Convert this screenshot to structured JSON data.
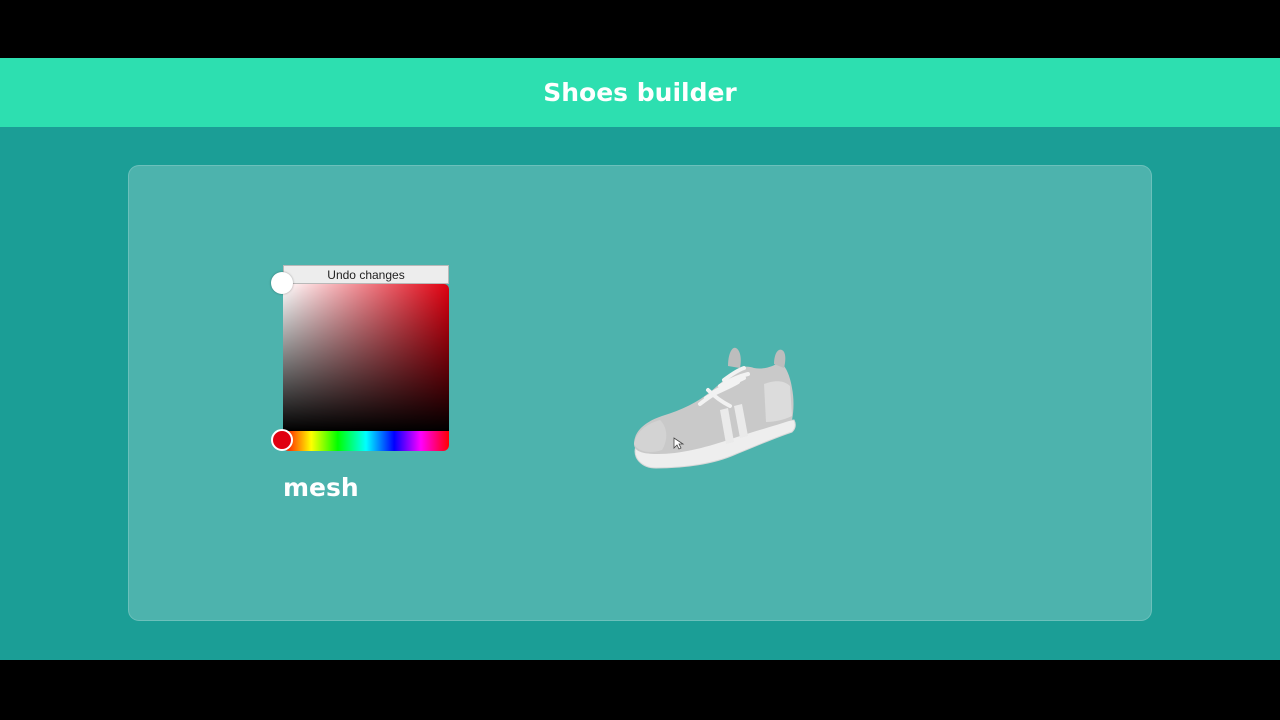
{
  "header": {
    "title": "Shoes builder"
  },
  "color_picker": {
    "undo_label": "Undo changes",
    "selected_color": "#e00010",
    "hue_color": "#ff0000"
  },
  "part": {
    "label": "mesh"
  },
  "shoe": {
    "icon": "shoe-3d-model",
    "color": "#c9c9c9"
  },
  "colors": {
    "header_bg": "#2ddfb0",
    "app_bg": "#1b9e96",
    "panel_bg": "rgba(255,255,255,0.22)"
  }
}
